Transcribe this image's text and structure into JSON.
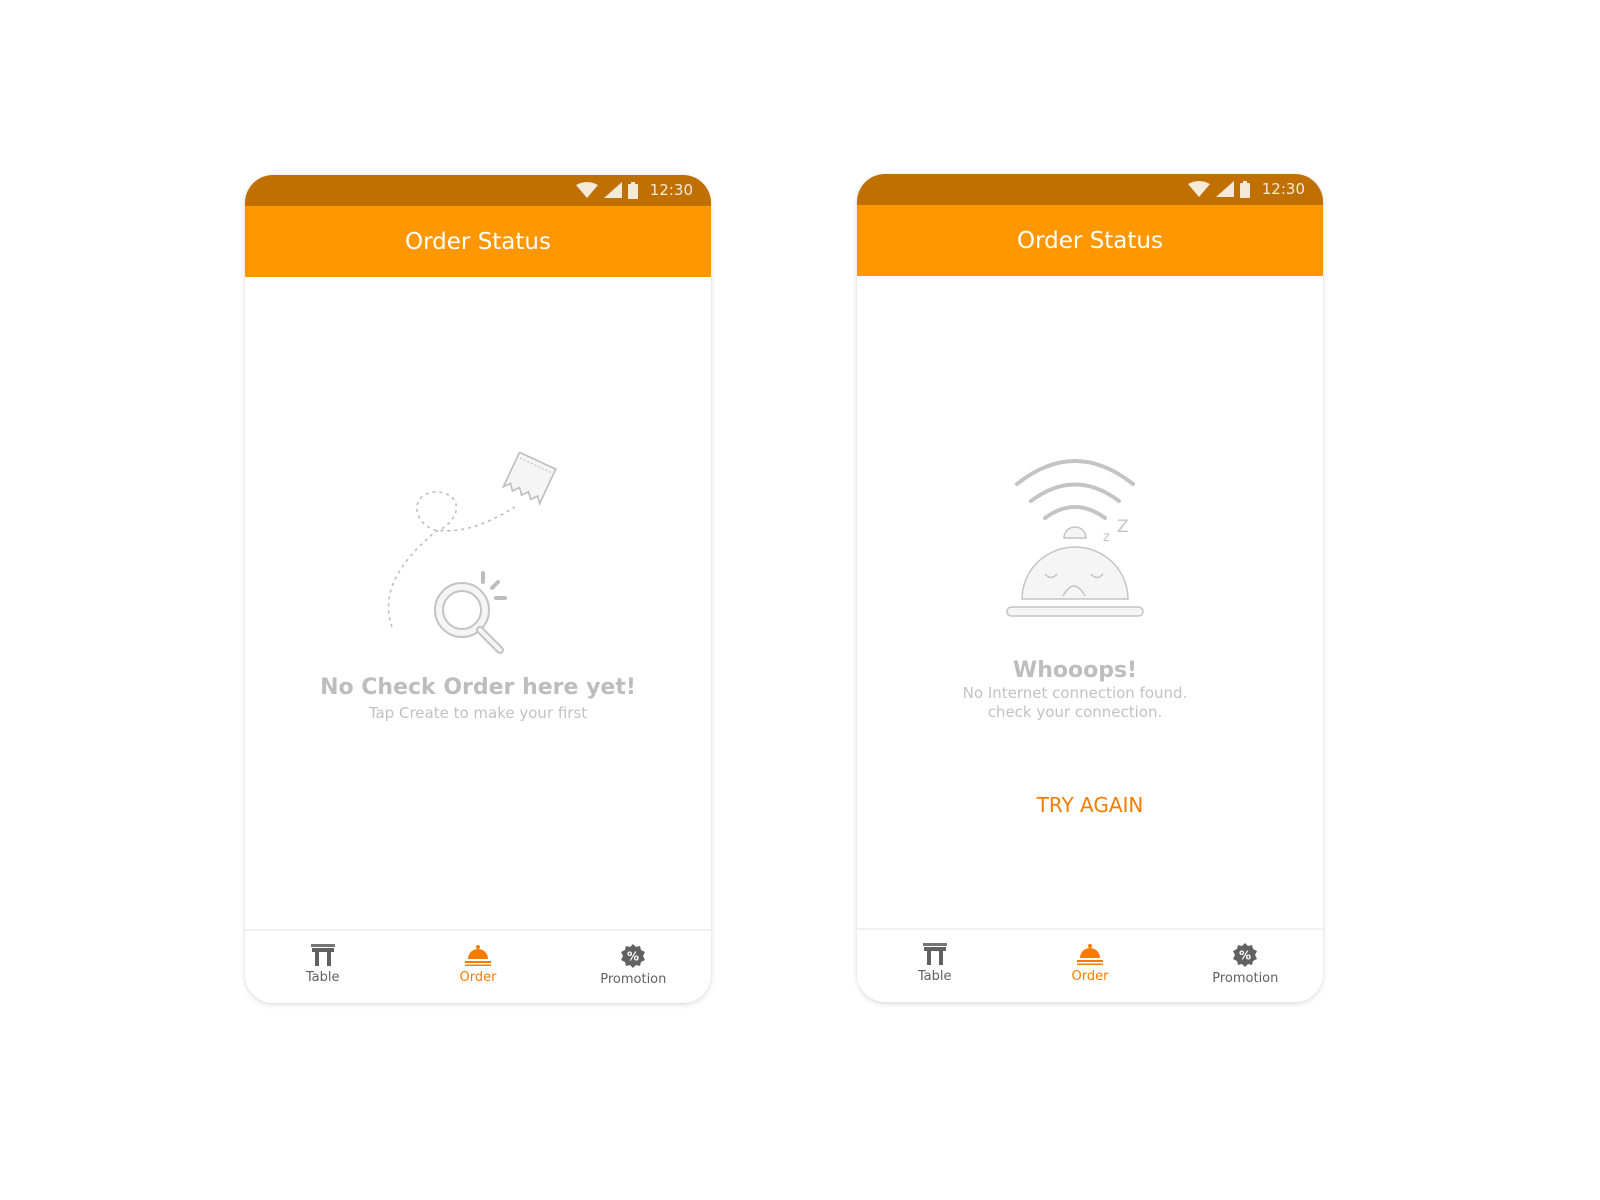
{
  "colors": {
    "status_bar": "#c07000",
    "app_bar": "#ff9800",
    "accent": "#f57c00",
    "muted_text": "#bdbdbd",
    "nav_inactive": "#616161"
  },
  "screens": [
    {
      "status": {
        "time": "12:30",
        "icons": [
          "wifi-icon",
          "signal-icon",
          "battery-icon"
        ]
      },
      "app_bar": {
        "title": "Order Status"
      },
      "empty_state": {
        "illustration": "magnifier-searching-receipt",
        "title": "No Check Order here yet!",
        "subtitle": "Tap Create to make your first"
      },
      "bottom_nav": [
        {
          "label": "Table",
          "icon": "table-icon",
          "active": false
        },
        {
          "label": "Order",
          "icon": "service-bell-icon",
          "active": true
        },
        {
          "label": "Promotion",
          "icon": "discount-badge-icon",
          "active": false
        }
      ]
    },
    {
      "status": {
        "time": "12:30",
        "icons": [
          "wifi-icon",
          "signal-icon",
          "battery-icon"
        ]
      },
      "app_bar": {
        "title": "Order Status"
      },
      "error_state": {
        "illustration": "sleeping-bell-wifi",
        "title": "Whooops!",
        "subtitle_line1": "No Internet connection found.",
        "subtitle_line2": "check your connection.",
        "action_label": "TRY AGAIN"
      },
      "bottom_nav": [
        {
          "label": "Table",
          "icon": "table-icon",
          "active": false
        },
        {
          "label": "Order",
          "icon": "service-bell-icon",
          "active": true
        },
        {
          "label": "Promotion",
          "icon": "discount-badge-icon",
          "active": false
        }
      ]
    }
  ]
}
